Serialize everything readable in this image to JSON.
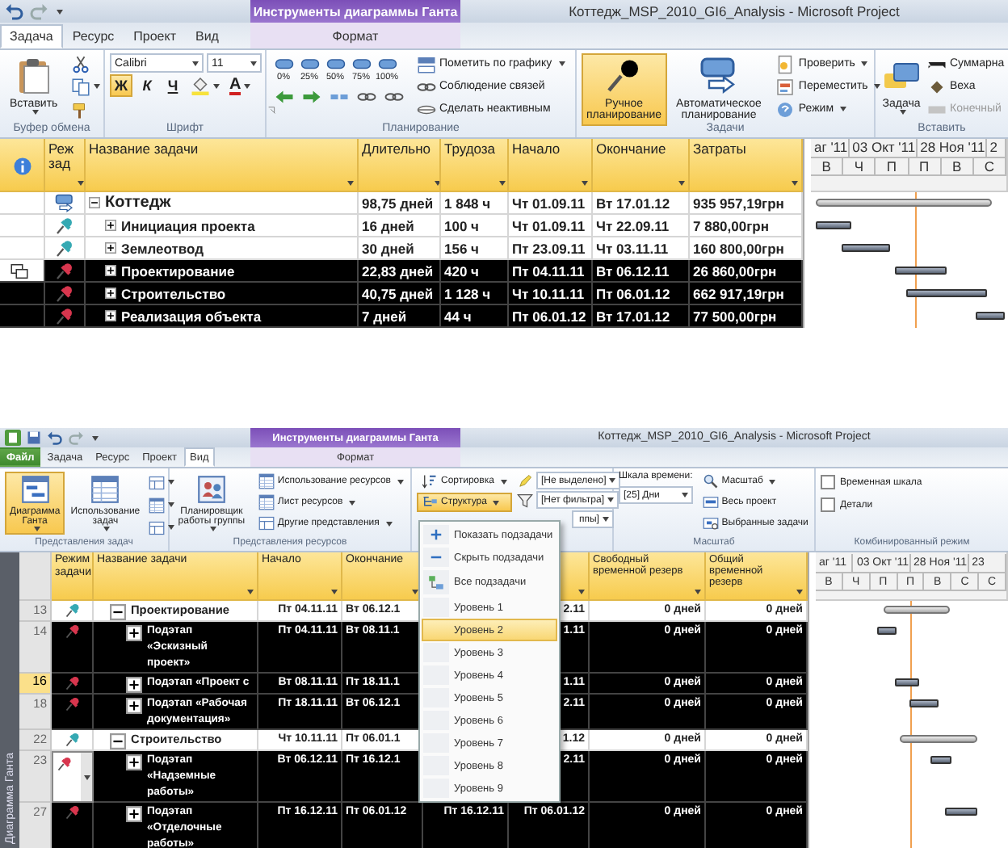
{
  "top": {
    "window": {
      "title": "Коттедж_MSP_2010_GI6_Analysis - Microsoft Project"
    },
    "contextual_tab": "Инструменты диаграммы Ганта",
    "tabs": [
      {
        "label": "Задача",
        "selected": true,
        "kind": "normal"
      },
      {
        "label": "Ресурс",
        "selected": false,
        "kind": "normal"
      },
      {
        "label": "Проект",
        "selected": false,
        "kind": "normal"
      },
      {
        "label": "Вид",
        "selected": false,
        "kind": "normal"
      },
      {
        "label": "Формат",
        "selected": false,
        "kind": "contextual"
      }
    ],
    "ribbon": [
      {
        "kind": "clipboard",
        "label": "Буфер обмена",
        "commands": [
          {
            "label": "Вставить"
          }
        ]
      },
      {
        "kind": "font",
        "label": "Шрифт",
        "fields": [
          {
            "value": "Calibri"
          },
          {
            "value": "11"
          }
        ],
        "toggles": [
          {
            "label": "Ж",
            "on": true
          },
          {
            "label": "К",
            "on": false
          },
          {
            "label": "Ч",
            "on": false
          }
        ],
        "commands": [
          {
            "label": "A"
          }
        ]
      },
      {
        "kind": "schedule",
        "label": "Планирование",
        "percent_buttons": [
          "0%",
          "25%",
          "50%",
          "75%",
          "100%"
        ],
        "commands": [
          {
            "label": "Пометить по графику"
          },
          {
            "label": "Соблюдение связей"
          },
          {
            "label": "Сделать неактивным"
          }
        ]
      },
      {
        "kind": "tasks",
        "label": "Задачи",
        "commands": [
          {
            "label": "Ручное планирование",
            "selected": true
          },
          {
            "label": "Автоматическое планирование",
            "selected": false
          },
          {
            "label": "Проверить"
          },
          {
            "label": "Переместить"
          },
          {
            "label": "Режим"
          }
        ]
      },
      {
        "kind": "insert",
        "label": "Вставить",
        "commands": [
          {
            "label": "Задача",
            "disabled": false
          },
          {
            "label": "Суммарна",
            "disabled": false
          },
          {
            "label": "Веха",
            "disabled": false
          },
          {
            "label": "Конечный",
            "disabled": true
          }
        ]
      }
    ],
    "table": {
      "columns": [
        "Реж зад",
        "Название задачи",
        "Длительно",
        "Трудоза",
        "Начало",
        "Окончание",
        "Затраты"
      ],
      "rows": [
        {
          "name": "Коттедж",
          "manually_scheduled": false,
          "summary": true,
          "expanded": true,
          "selected": false,
          "indicator": false,
          "duration": "98,75 дней",
          "work": "1 848 ч",
          "start": "Чт 01.09.11",
          "finish": "Вт 17.01.12",
          "cost": "935 957,19грн",
          "children": [
            {
              "name": "Инициация проекта",
              "manually_scheduled": true,
              "summary": false,
              "expanded": false,
              "selected": false,
              "indicator": false,
              "duration": "16 дней",
              "work": "100 ч",
              "start": "Чт 01.09.11",
              "finish": "Чт 22.09.11",
              "cost": "7 880,00грн"
            },
            {
              "name": "Землеотвод",
              "manually_scheduled": true,
              "summary": false,
              "expanded": false,
              "selected": false,
              "indicator": false,
              "duration": "30 дней",
              "work": "156 ч",
              "start": "Пт 23.09.11",
              "finish": "Чт 03.11.11",
              "cost": "160 800,00грн"
            },
            {
              "name": "Проектирование",
              "manually_scheduled": true,
              "summary": false,
              "expanded": false,
              "selected": true,
              "indicator": true,
              "duration": "22,83 дней",
              "work": "420 ч",
              "start": "Пт 04.11.11",
              "finish": "Вт 06.12.11",
              "cost": "26 860,00грн"
            },
            {
              "name": "Строительство",
              "manually_scheduled": true,
              "summary": false,
              "expanded": false,
              "selected": true,
              "indicator": false,
              "duration": "40,75 дней",
              "work": "1 128 ч",
              "start": "Чт 10.11.11",
              "finish": "Пт 06.01.12",
              "cost": "662 917,19грн"
            },
            {
              "name": "Реализация объекта",
              "manually_scheduled": true,
              "summary": false,
              "expanded": false,
              "selected": true,
              "indicator": false,
              "duration": "7 дней",
              "work": "44 ч",
              "start": "Пт 06.01.12",
              "finish": "Вт 17.01.12",
              "cost": "77 500,00грн"
            }
          ]
        }
      ]
    },
    "gantt": {
      "timescale_major": [
        "аг '11",
        "03 Окт '11",
        "28 Ноя '11",
        "2"
      ],
      "timescale_minor": [
        "В",
        "Ч",
        "П",
        "П",
        "В",
        "С"
      ]
    }
  },
  "bottom": {
    "window": {
      "title": "Коттедж_MSP_2010_GI6_Analysis - Microsoft Project"
    },
    "contextual_tab": "Инструменты диаграммы Ганта",
    "tabs": [
      {
        "label": "Файл",
        "selected": false,
        "kind": "file"
      },
      {
        "label": "Задача",
        "selected": false,
        "kind": "normal"
      },
      {
        "label": "Ресурс",
        "selected": false,
        "kind": "normal"
      },
      {
        "label": "Проект",
        "selected": false,
        "kind": "normal"
      },
      {
        "label": "Вид",
        "selected": true,
        "kind": "normal"
      },
      {
        "label": "Формат",
        "selected": false,
        "kind": "contextual"
      }
    ],
    "ribbon": [
      {
        "kind": "task_views",
        "label": "Представления задач",
        "commands": [
          {
            "label": "Диаграмма Ганта",
            "selected": true
          },
          {
            "label": "Использование задач",
            "selected": false
          }
        ]
      },
      {
        "kind": "resource_views",
        "label": "Представления ресурсов",
        "commands": [
          {
            "label": "Планировщик работы группы"
          },
          {
            "label": "Использование ресурсов"
          },
          {
            "label": "Лист ресурсов"
          },
          {
            "label": "Другие представления"
          }
        ]
      },
      {
        "kind": "data",
        "commands": [
          {
            "label": "Сортировка",
            "selected": false
          },
          {
            "label": "Структура",
            "selected": true
          }
        ],
        "fields": [
          {
            "value": "[Не выделено]"
          },
          {
            "value": "[Нет фильтра]"
          },
          {
            "value": "ппы]"
          }
        ]
      },
      {
        "kind": "zoom",
        "label": "Масштаб",
        "timescale_label": "Шкала времени:",
        "fields": [
          {
            "value": "[25] Дни"
          }
        ],
        "commands": [
          {
            "label": "Масштаб"
          },
          {
            "label": "Весь проект"
          },
          {
            "label": "Выбранные задачи"
          }
        ]
      },
      {
        "kind": "split",
        "label": "Комбинированный режим",
        "checkboxes": [
          {
            "label": "Временная шкала",
            "checked": false
          },
          {
            "label": "Детали",
            "checked": false
          }
        ]
      }
    ],
    "outline_menu": {
      "items": [
        {
          "label": "Показать подзадачи",
          "selected": false
        },
        {
          "label": "Скрыть подзадачи",
          "selected": false
        },
        {
          "label": "Все подзадачи",
          "selected": false
        },
        {
          "label": "Уровень 1",
          "selected": false
        },
        {
          "label": "Уровень 2",
          "selected": true
        },
        {
          "label": "Уровень 3",
          "selected": false
        },
        {
          "label": "Уровень 4",
          "selected": false
        },
        {
          "label": "Уровень 5",
          "selected": false
        },
        {
          "label": "Уровень 6",
          "selected": false
        },
        {
          "label": "Уровень 7",
          "selected": false
        },
        {
          "label": "Уровень 8",
          "selected": false
        },
        {
          "label": "Уровень 9",
          "selected": false
        }
      ]
    },
    "view_bar": {
      "label": "Диаграмма Ганта"
    },
    "table": {
      "columns": [
        "Режим задачи",
        "Название задачи",
        "Начало",
        "Окончание",
        "Свободный временной резерв",
        "Общий временной резерв"
      ],
      "rows": [
        {
          "id": "13",
          "name": "Проектирование",
          "manually_scheduled": true,
          "summary": true,
          "expanded": true,
          "selected": false,
          "active": false,
          "editing": false,
          "start": "Пт 04.11.11",
          "finish": "Вт 06.12.1",
          "column_6": "2.11",
          "free_slack": "0 дней",
          "total_slack": "0 дней",
          "children": [
            {
              "id": "14",
              "name": "Подэтап «Эскизный проект»",
              "manually_scheduled": true,
              "summary": false,
              "expanded": false,
              "selected": true,
              "active": false,
              "editing": false,
              "start": "Пт 04.11.11",
              "finish": "Вт 08.11.1",
              "column_6": "1.11",
              "free_slack": "0 дней",
              "total_slack": "0 дней"
            },
            {
              "id": "16",
              "name": "Подэтап «Проект с",
              "manually_scheduled": true,
              "summary": false,
              "expanded": false,
              "selected": true,
              "active": true,
              "editing": false,
              "start": "Вт 08.11.11",
              "finish": "Пт 18.11.1",
              "column_6": "1.11",
              "free_slack": "0 дней",
              "total_slack": "0 дней"
            },
            {
              "id": "18",
              "name": "Подэтап «Рабочая документация»",
              "manually_scheduled": true,
              "summary": false,
              "expanded": false,
              "selected": true,
              "active": false,
              "editing": false,
              "start": "Пт 18.11.11",
              "finish": "Вт 06.12.1",
              "column_6": "2.11",
              "free_slack": "0 дней",
              "total_slack": "0 дней"
            }
          ]
        },
        {
          "id": "22",
          "name": "Строительство",
          "manually_scheduled": true,
          "summary": true,
          "expanded": true,
          "selected": false,
          "active": false,
          "editing": false,
          "start": "Чт 10.11.11",
          "finish": "Пт 06.01.1",
          "column_6": "1.12",
          "free_slack": "0 дней",
          "total_slack": "0 дней",
          "children": [
            {
              "id": "23",
              "name": "Подэтап «Надземные работы»",
              "manually_scheduled": true,
              "summary": false,
              "expanded": false,
              "selected": true,
              "active": false,
              "editing": true,
              "start": "Вт 06.12.11",
              "finish": "Пт 16.12.1",
              "column_6": "2.11",
              "free_slack": "0 дней",
              "total_slack": "0 дней"
            },
            {
              "id": "27",
              "name": "Подэтап «Отделочные работы»",
              "manually_scheduled": true,
              "summary": false,
              "expanded": false,
              "selected": true,
              "active": false,
              "editing": false,
              "start": "Пт 16.12.11",
              "finish": "Пт 06.01.12",
              "column_5": "Пт 16.12.11",
              "column_6": "Пт 06.01.12",
              "free_slack": "0 дней",
              "total_slack": "0 дней"
            }
          ]
        }
      ]
    },
    "gantt": {
      "timescale_major": [
        "аг '11",
        "03 Окт '11",
        "28 Ноя '11",
        "23"
      ],
      "timescale_minor": [
        "В",
        "Ч",
        "П",
        "П",
        "В",
        "С",
        "С"
      ]
    }
  }
}
